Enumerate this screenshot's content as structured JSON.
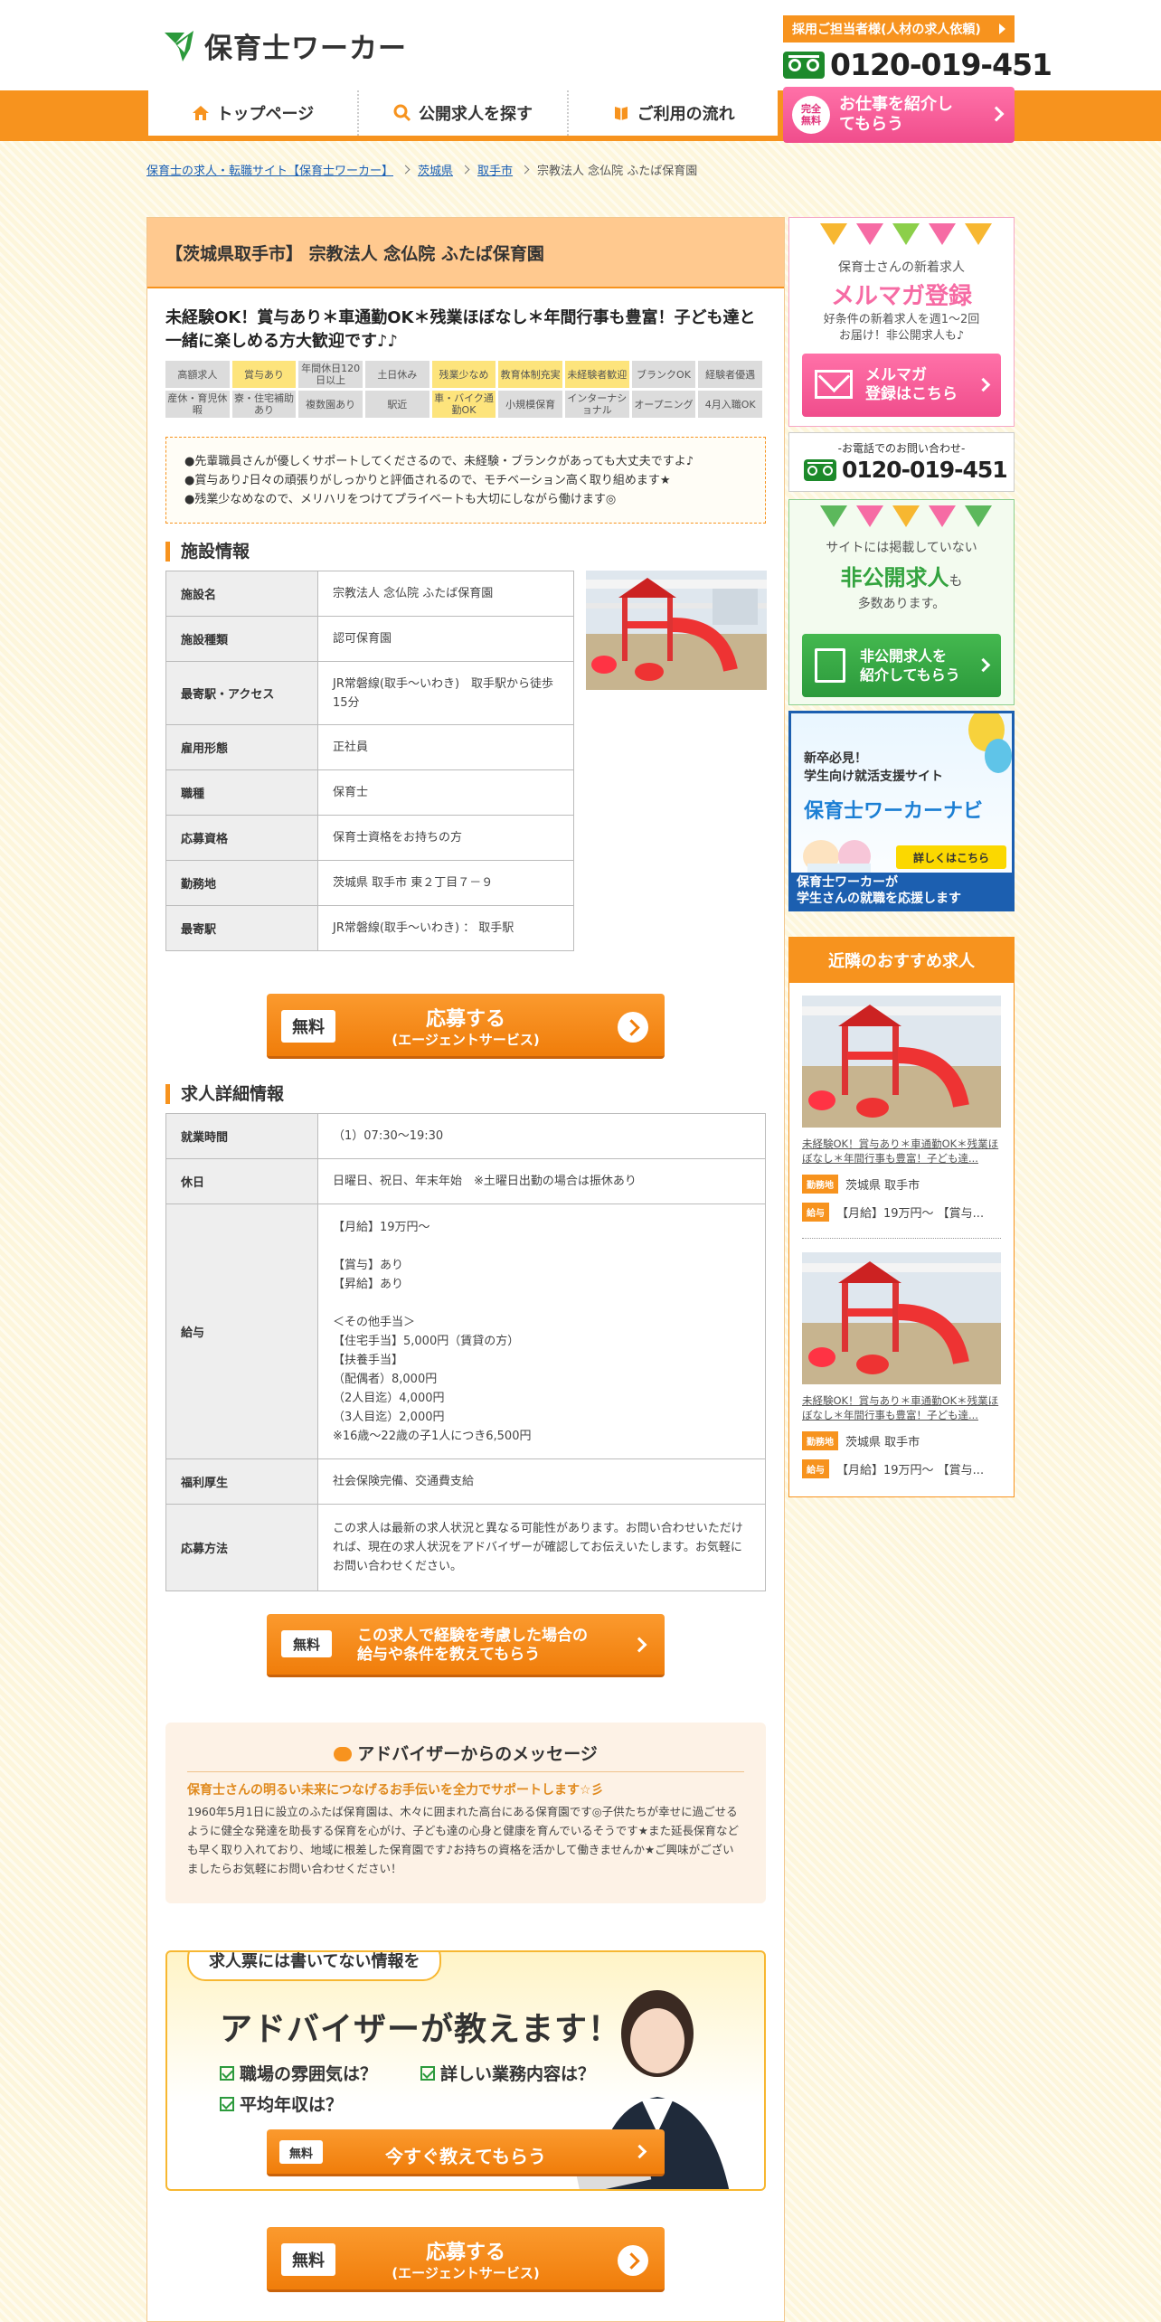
{
  "header": {
    "logo": "保育士ワーカー",
    "hr_button": "採用ご担当者様(人材の求人依頼)",
    "phone": "0120-019-451",
    "cta_badge": "完全無料",
    "cta_label": "お仕事を紹介してもらう"
  },
  "nav": [
    "トップページ",
    "公開求人を探す",
    "ご利用の流れ"
  ],
  "breadcrumb": [
    "保育士の求人・転職サイト【保育士ワーカー】",
    "茨城県",
    "取手市",
    "宗教法人 念仏院 ふたば保育園"
  ],
  "job": {
    "header_title": "【茨城県取手市】 宗教法人 念仏院 ふたば保育園",
    "lead": "未経験OK！賞与あり＊車通勤OK＊残業ほぼなし＊年間行事も豊富！子ども達と一緒に楽しめる方大歓迎です♪♪",
    "tags": [
      {
        "label": "高額求人",
        "on": false
      },
      {
        "label": "賞与あり",
        "on": true
      },
      {
        "label": "年間休日120日以上",
        "on": false
      },
      {
        "label": "土日休み",
        "on": false
      },
      {
        "label": "残業少なめ",
        "on": true
      },
      {
        "label": "教育体制充実",
        "on": true
      },
      {
        "label": "未経験者歓迎",
        "on": true
      },
      {
        "label": "ブランクOK",
        "on": false
      },
      {
        "label": "経験者優遇",
        "on": false
      },
      {
        "label": "産休・育児休暇",
        "on": false
      },
      {
        "label": "寮・住宅補助あり",
        "on": false
      },
      {
        "label": "複数園あり",
        "on": false
      },
      {
        "label": "駅近",
        "on": false
      },
      {
        "label": "車・バイク通勤OK",
        "on": true
      },
      {
        "label": "小規模保育",
        "on": false
      },
      {
        "label": "インターナショナル",
        "on": false
      },
      {
        "label": "オープニング",
        "on": false
      },
      {
        "label": "4月入職OK",
        "on": false
      }
    ],
    "points": [
      "●先輩職員さんが優しくサポートしてくださるので、未経験・ブランクがあっても大丈夫ですよ♪",
      "●賞与あり♪日々の頑張りがしっかりと評価されるので、モチベーション高く取り組めます★",
      "●残業少なめなので、メリハリをつけてプライベートも大切にしながら働けます◎"
    ],
    "facility_title": "施設情報",
    "facility": [
      {
        "k": "施設名",
        "v": "宗教法人 念仏院 ふたば保育園"
      },
      {
        "k": "施設種類",
        "v": "認可保育園"
      },
      {
        "k": "最寄駅・アクセス",
        "v": "JR常磐線(取手～いわき)　取手駅から徒歩15分"
      },
      {
        "k": "雇用形態",
        "v": "正社員"
      },
      {
        "k": "職種",
        "v": "保育士"
      },
      {
        "k": "応募資格",
        "v": "保育士資格をお持ちの方"
      },
      {
        "k": "勤務地",
        "v": "茨城県 取手市 東２丁目７－９"
      },
      {
        "k": "最寄駅",
        "v": "JR常磐線(取手～いわき) ： 取手駅"
      }
    ],
    "apply": {
      "free": "無料",
      "main": "応募する",
      "sub": "(エージェントサービス)"
    },
    "detail_title": "求人詳細情報",
    "detail": [
      {
        "k": "就業時間",
        "v": "（1）07:30〜19:30"
      },
      {
        "k": "休日",
        "v": "日曜日、祝日、年末年始　※土曜日出勤の場合は振休あり"
      },
      {
        "k": "給与",
        "v": "【月給】19万円～\n\n【賞与】あり\n【昇給】あり\n\n＜その他手当＞\n【住宅手当】5,000円（賃貸の方）\n【扶養手当】\n（配偶者）8,000円\n（2人目迄）4,000円\n（3人目迄）2,000円\n※16歳～22歳の子1人につき6,500円"
      },
      {
        "k": "福利厚生",
        "v": "社会保険完備、交通費支給"
      },
      {
        "k": "応募方法",
        "v": "この求人は最新の求人状況と異なる可能性があります。お問い合わせいただければ、現在の求人状況をアドバイザーが確認してお伝えいたします。お気軽にお問い合わせください。"
      }
    ],
    "consult_btn": {
      "free": "無料",
      "label": "この求人で経験を考慮した場合の給与や条件を教えてもらう"
    },
    "advisor": {
      "title": "アドバイザーからのメッセージ",
      "subtitle": "保育士さんの明るい未来につなげるお手伝いを全力でサポートします☆彡",
      "body": "1960年5月1日に設立のふたば保育園は、木々に囲まれた高台にある保育園です◎子供たちが幸せに過ごせるように健全な発達を助長する保育を心がけ、子ども達の心身と健康を育んでいるそうです★また延長保育なども早く取り入れており、地域に根差した保育園です♪お持ちの資格を活かして働きませんか★ご興味がございましたらお気軽にお問い合わせください！"
    },
    "banner": {
      "bubble": "求人票には書いてない情報を",
      "big": "アドバイザーが教えます！",
      "q1": "職場の雰囲気は？",
      "q2": "詳しい業務内容は？",
      "q3": "平均年収は？",
      "btn_free": "無料",
      "btn_label": "今すぐ教えてもらう"
    }
  },
  "sidebar": {
    "mailmag": {
      "sub": "保育士さんの新着求人",
      "title": "メルマガ登録",
      "desc": "好条件の新着求人を週1～2回\nお届け！非公開求人も♪",
      "btn": "メルマガ\n登録はこちら"
    },
    "tel": {
      "label": "-お電話でのお問い合わせ-",
      "number": "0120-019-451"
    },
    "private": {
      "sub": "サイトには掲載していない",
      "title": "非公開求人",
      "title_suffix": "も",
      "desc": "多数あります。",
      "btn": "非公開求人を\n紹介してもらう"
    },
    "navi": {
      "t1": "新卒必見！\n学生向け就活支援サイト",
      "t2": "保育士ワーカーナビ",
      "btn": "詳しくはこちら",
      "foot": "保育士ワーカーが\n学生さんの就職を応援します"
    },
    "near": {
      "title": "近隣のおすすめ求人",
      "items": [
        {
          "title": "未経験OK！賞与あり＊車通勤OK＊残業ほぼなし＊年間行事も豊富！子ども達...",
          "loc_label": "勤務地",
          "loc": "茨城県 取手市",
          "pay_label": "給与",
          "pay": "【月給】19万円～ 【賞与..."
        },
        {
          "title": "未経験OK！賞与あり＊車通勤OK＊残業ほぼなし＊年間行事も豊富！子ども達...",
          "loc_label": "勤務地",
          "loc": "茨城県 取手市",
          "pay_label": "給与",
          "pay": "【月給】19万円～ 【賞与..."
        }
      ]
    }
  }
}
